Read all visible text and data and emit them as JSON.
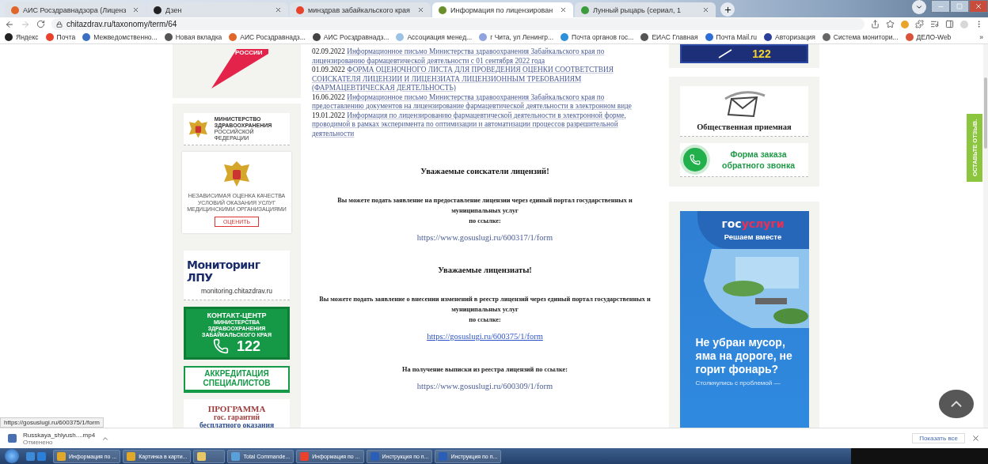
{
  "browser": {
    "tabs": [
      {
        "title": "АИС Росздравнадзора (Лиценз",
        "kind": "orange",
        "selected": false
      },
      {
        "title": "Дзен",
        "kind": "dark",
        "selected": false
      },
      {
        "title": "минздрав забайкальского края",
        "kind": "yandex",
        "selected": false
      },
      {
        "title": "Информация по лицензирован",
        "kind": "leaf",
        "selected": true
      },
      {
        "title": "Лунный рыцарь (сериал, 1",
        "kind": "video",
        "selected": false
      }
    ],
    "address": "chitazdrav.ru/taxonomy/term/64",
    "bookmarks": [
      {
        "label": "Яндекс",
        "color": "#222222"
      },
      {
        "label": "Почта",
        "color": "#e8412c"
      },
      {
        "label": "Межведомственно...",
        "color": "#3b6fc2"
      },
      {
        "label": "Новая вкладка",
        "color": "#555555"
      },
      {
        "label": "АИС Росздравнадз...",
        "color": "#e0662a"
      },
      {
        "label": "АИС Росздравнадз...",
        "color": "#444444"
      },
      {
        "label": "Ассоциация менед...",
        "color": "#9cc3e6"
      },
      {
        "label": "г Чита, ул Ленингр...",
        "color": "#8fa3e0"
      },
      {
        "label": "Почта органов гос...",
        "color": "#2f8fd8"
      },
      {
        "label": "ЕИАС Главная",
        "color": "#555555"
      },
      {
        "label": "Почта Mail.ru",
        "color": "#2d6fd6"
      },
      {
        "label": "Авторизация",
        "color": "#2a3e9c"
      },
      {
        "label": "Система монитори...",
        "color": "#666666"
      },
      {
        "label": "ДЕЛО-Web",
        "color": "#d9533a"
      }
    ],
    "bookmarks_more": "»"
  },
  "left_sidebar": {
    "top_banner_text": "РОССИИ",
    "ministry_logo": {
      "line_1": "МИНИСТЕРСТВО",
      "line_2": "ЗДРАВООХРАНЕНИЯ",
      "line_3": "РОССИЙСКОЙ ФЕДЕРАЦИИ"
    },
    "rating": {
      "text": "НЕЗАВИСИМАЯ ОЦЕНКА КАЧЕСТВА УСЛОВИЙ ОКАЗАНИЯ УСЛУГ МЕДИЦИНСКИМИ ОРГАНИЗАЦИЯМИ",
      "button": "ОЦЕНИТЬ"
    },
    "monitoring": {
      "title": "Мониторинг ЛПУ",
      "url": "monitoring.chitazdrav.ru"
    },
    "contact_center": {
      "title": "КОНТАКТ-ЦЕНТР",
      "subtitle": "МИНИСТЕРСТВА ЗДРАВООХРАНЕНИЯ ЗАБАЙКАЛЬСКОГО КРАЯ",
      "number": "122"
    },
    "accreditation": "АККРЕДИТАЦИЯ СПЕЦИАЛИСТОВ",
    "program": {
      "title": "ПРОГРАММА",
      "line_2": "гос. гарантий",
      "line_3": "бесплатного оказания"
    }
  },
  "news": [
    {
      "date": "02.09.2022",
      "title": "Информационное письмо Министерства здравоохранения Забайкальского края по лицензированию фармацевтической деятельности с 01 сентября 2022 года"
    },
    {
      "date": "01.09.2022",
      "title": "ФОРМА ОЦЕНОЧНОГО ЛИСТА ДЛЯ ПРОВЕДЕНИЯ ОЦЕНКИ СООТВЕТСТВИЯ СОИСКАТЕЛЯ ЛИЦЕНЗИИ И ЛИЦЕНЗИАТА ЛИЦЕНЗИОННЫМ ТРЕБОВАНИЯМ (ФАРМАЦЕВТИЧЕСКАЯ ДЕЯТЕЛЬНОСТЬ)"
    },
    {
      "date": "16.06.2022",
      "title": "Информационное письмо Министерства здравоохранения Забайкальского края по предоставлению документов на лицензирование фармацевтической деятельности в электронном виде"
    },
    {
      "date": "19.01.2022",
      "title": "Информация по лицензированию фармацевтической деятельности в электронной форме, проводимой в рамках эксперимента по оптимизации и автоматизации процессов разрешительной деятельности"
    }
  ],
  "sections": [
    {
      "heading": "Уважаемые соискатели лицензий!",
      "text": "Вы можете подать заявление на предоставление лицензии через единый портал государственных и муниципальных услуг",
      "by_link": "по ссылке:",
      "link": "https://www.gosuslugi.ru/600317/1/form",
      "hovered": false
    },
    {
      "heading": "Уважаемые лицензиаты!",
      "text": "Вы можете подать заявление о внесении изменений в реестр лицензий через единый портал государственных и муниципальных услуг",
      "by_link": "по ссылке:",
      "link": "https://gosuslugi.ru/600375/1/form",
      "hovered": true
    },
    {
      "text": "На получение выписки из реестра лицензий по ссылке:",
      "link": "https://www.gosuslugi.ru/600309/1/form",
      "hovered": false
    }
  ],
  "right_sidebar": {
    "top_banner_number": "122",
    "reception": "Общественная приемная",
    "callback": "Форма заказа обратного звонка",
    "gosuslugi": {
      "logo_prefix": "гос",
      "logo_suffix": "услуги",
      "slogan": "Решаем вместе",
      "question": "Не убран мусор, яма на дороге, не горит фонарь?",
      "footer": "Столкнулись с проблемой —"
    }
  },
  "feedback_tab": "ОСТАВЬТЕ ОТЗЫВ.",
  "status_url": "https://gosuslugi.ru/600375/1/form",
  "download": {
    "file": "Russkaya_shlyush....mp4",
    "status": "Отменено",
    "show_all": "Показать все"
  },
  "taskbar": [
    {
      "label": "Информация по ...",
      "kind": "chrome"
    },
    {
      "label": "Картинка в карти...",
      "kind": "chrome"
    },
    {
      "kind": "folder"
    },
    {
      "label": "Total Commande...",
      "kind": "totalcmd"
    },
    {
      "label": "Информация по ...",
      "kind": "yandex"
    },
    {
      "label": "Инструкция по п...",
      "kind": "word"
    },
    {
      "label": "Инструкция по п...",
      "kind": "word"
    }
  ]
}
